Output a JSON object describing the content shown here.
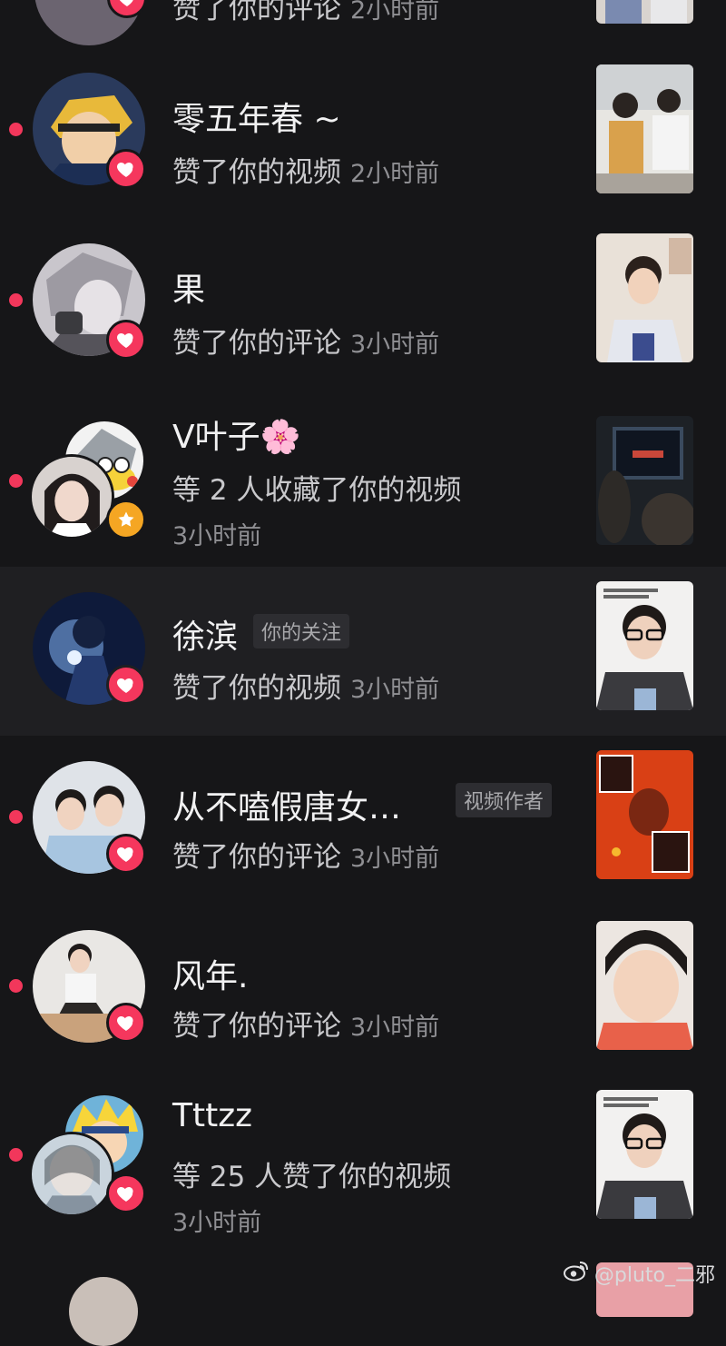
{
  "top_partial": {
    "action": "赞了你的评论",
    "time": "2小时前"
  },
  "notifications": [
    {
      "name": "零五年春 ~",
      "action": "赞了你的视频",
      "time": "2小时前",
      "badge": "heart-icon"
    },
    {
      "name": "果",
      "action": "赞了你的评论",
      "time": "3小时前",
      "badge": "heart-icon"
    },
    {
      "name": "V叶子",
      "name_emoji": "🌸",
      "action": "等 2 人收藏了你的视频",
      "time": "3小时前",
      "badge": "star-icon"
    },
    {
      "name": "徐滨",
      "tag": "你的关注",
      "action": "赞了你的视频",
      "time": "3小时前",
      "badge": "heart-icon"
    },
    {
      "name": "从不嗑假唐女…",
      "tag": "视频作者",
      "action": "赞了你的评论",
      "time": "3小时前",
      "badge": "heart-icon"
    },
    {
      "name": "风年.",
      "action": "赞了你的评论",
      "time": "3小时前",
      "badge": "heart-icon"
    },
    {
      "name": "Tttzz",
      "action": "等 25 人赞了你的视频",
      "time": "3小时前",
      "badge": "heart-icon"
    }
  ],
  "watermark": {
    "text": "@pluto_二邪",
    "icon": "weibo-icon"
  },
  "colors": {
    "background": "#161618",
    "unread_dot": "#f2375b",
    "heart_badge": "#f5375d",
    "star_badge": "#f5a623"
  }
}
